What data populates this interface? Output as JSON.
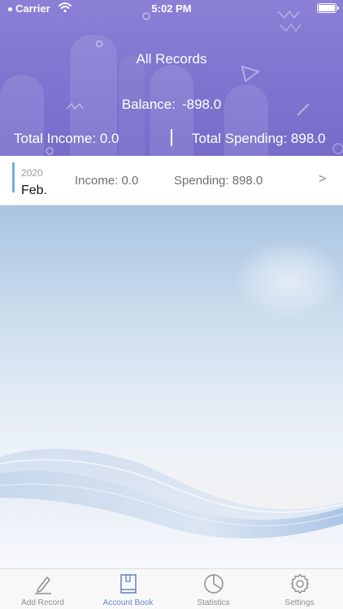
{
  "status_bar": {
    "carrier": "Carrier",
    "time": "5:02 PM"
  },
  "header": {
    "title": "All Records",
    "balance_label": "Balance:",
    "balance_value": "-898.0",
    "total_income": "Total Income: 0.0",
    "total_spending": "Total Spending: 898.0"
  },
  "records": [
    {
      "year": "2020",
      "month": "Feb.",
      "income": "Income: 0.0",
      "spending": "Spending: 898.0",
      "chevron": ">"
    }
  ],
  "tabbar": {
    "tabs": [
      {
        "label": "Add Record",
        "icon": "pencil-icon",
        "active": false
      },
      {
        "label": "Account Book",
        "icon": "book-icon",
        "active": true
      },
      {
        "label": "Statistics",
        "icon": "pie-chart-icon",
        "active": false
      },
      {
        "label": "Settings",
        "icon": "gear-icon",
        "active": false
      }
    ]
  },
  "colors": {
    "header_bg": "#7d74cf",
    "accent_line": "#6fb0d8",
    "active_tab": "#6d86c8",
    "inactive_tab": "#8e8e8e"
  }
}
